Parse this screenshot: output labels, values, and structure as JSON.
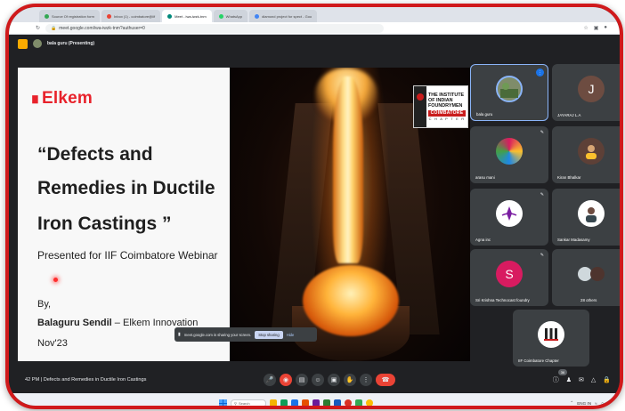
{
  "browser": {
    "tabs": [
      {
        "label": "Source Of registration form",
        "color": "#34a853",
        "active": false
      },
      {
        "label": "Inbox (1) - coimbatore@iif",
        "color": "#ea4335",
        "active": false
      },
      {
        "label": "Meet - iwa-iwzk-tnm",
        "color": "#00897b",
        "active": true
      },
      {
        "label": "WhatsApp",
        "color": "#25d366",
        "active": false
      },
      {
        "label": "diamond project for spect - Goo",
        "color": "#4285f4",
        "active": false
      }
    ],
    "url": "meet.google.com/iwa-iwzk-tnm?authuser=0"
  },
  "meet": {
    "presenting_label": "bala guru (Presenting)"
  },
  "slide": {
    "logo": "Elkem",
    "title_lines": [
      "“Defects and",
      "Remedies in Ductile",
      "Iron Castings ”"
    ],
    "subtitle": "Presented for IIF Coimbatore Webinar",
    "by": "By,",
    "author_name": "Balaguru Sendil",
    "author_rest": " – Elkem Innovation",
    "date": "Nov'23",
    "badge": {
      "line1": "THE INSTITUTE",
      "line2": "OF INDIAN",
      "line3": "FOUNDRYMEN",
      "city": "COIMBATORE",
      "chapter": "C H A P T E R"
    }
  },
  "share_notice": {
    "text": "meet.google.com is sharing your screen.",
    "stop": "Stop sharing",
    "hide": "Hide"
  },
  "participants": [
    {
      "name": "bala guru",
      "initial": "",
      "color": "#7f8c6a",
      "active": true
    },
    {
      "name": "JAYARAJ L.A",
      "initial": "J",
      "color": "#6d4c41",
      "active": false
    },
    {
      "name": "arasu mani",
      "initial": "",
      "color": "#d81b60",
      "active": false
    },
    {
      "name": "Kiran Bhalkar",
      "initial": "",
      "color": "#5d4037",
      "active": false
    },
    {
      "name": "Agna inc",
      "initial": "",
      "color": "#ffffff",
      "active": false
    },
    {
      "name": "Sankar Madasamy",
      "initial": "",
      "color": "#ffffff",
      "active": false
    },
    {
      "name": "Sri Krishna Technocast foundry",
      "initial": "S",
      "color": "#d81b60",
      "active": false
    },
    {
      "name": "28 others",
      "initial": "",
      "color": "#4e342e",
      "active": false
    },
    {
      "name": "IIF Coimbatore Chapter",
      "initial": "",
      "color": "#ffffff",
      "active": false
    }
  ],
  "controls": {
    "meeting_info": "42 PM  |  Defects and Remedies in Ductile Iron Castings",
    "participant_count": "36"
  },
  "taskbar": {
    "search_placeholder": "Search",
    "language": "ENG IN"
  },
  "colors": {
    "frame_border": "#d0191b",
    "meet_bg": "#202124",
    "tile_bg": "#3c4043",
    "brand_red": "#e8222b",
    "end_call": "#ea4335"
  }
}
